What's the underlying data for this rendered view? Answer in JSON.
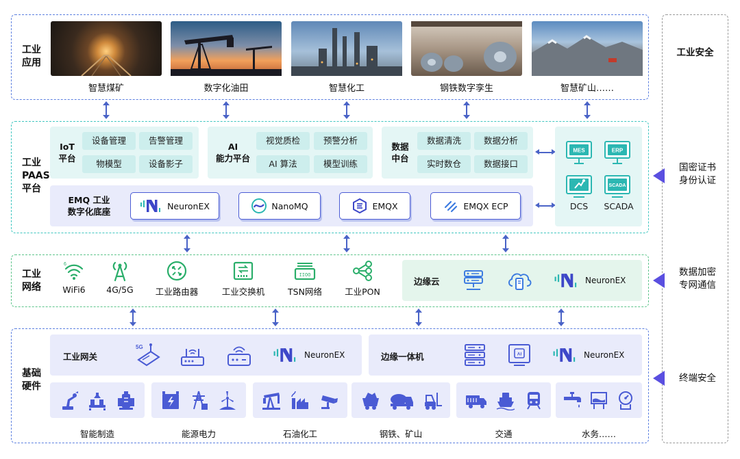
{
  "app": {
    "layers": [
      {
        "label": "工业\n应用"
      },
      {
        "label": "工业\nPAAS\n平台"
      },
      {
        "label": "工业\n网络"
      },
      {
        "label": "基础\n硬件"
      }
    ],
    "applications": [
      {
        "caption": "智慧煤矿"
      },
      {
        "caption": "数字化油田"
      },
      {
        "caption": "智慧化工"
      },
      {
        "caption": "钢铁数字孪生"
      },
      {
        "caption": "智慧矿山……"
      }
    ],
    "iot": {
      "label": "IoT\n平台",
      "items": [
        "设备管理",
        "告警管理",
        "物模型",
        "设备影子"
      ]
    },
    "ai": {
      "label": "AI\n能力平台",
      "items": [
        "视觉质检",
        "预警分析",
        "AI 算法",
        "模型训练"
      ]
    },
    "data_platform": {
      "label": "数据\n中台",
      "items": [
        "数据清洗",
        "数据分析",
        "实时数仓",
        "数据接口"
      ]
    },
    "emq_base": {
      "label": "EMQ 工业\n数字化底座",
      "products": [
        "NeuronEX",
        "NanoMQ",
        "EMQX",
        "EMQX ECP"
      ]
    },
    "systems": {
      "badges": [
        "MES",
        "ERP",
        "SCADA"
      ],
      "labels": [
        "DCS",
        "SCADA"
      ]
    },
    "network": {
      "items": [
        "WiFi6",
        "4G/5G",
        "工业路由器",
        "工业交换机",
        "TSN网络",
        "工业PON"
      ],
      "wifi_sub": "6",
      "edge_cloud": {
        "label": "边缘云",
        "product": "NeuronEX"
      }
    },
    "hardware": {
      "gateway": {
        "label": "工业网关",
        "product": "NeuronEX",
        "badge": "5G"
      },
      "edge_box": {
        "label": "边缘一体机",
        "product": "NeuronEX",
        "badge": "AI"
      },
      "groups": [
        "智能制造",
        "能源电力",
        "石油化工",
        "钢铁、矿山",
        "交通",
        "水务……"
      ]
    },
    "security": {
      "title": "工业安全",
      "items": [
        "国密证书\n身份认证",
        "数据加密\n专网通信",
        "终端安全"
      ]
    },
    "colors": {
      "accent": "#4a5bd4",
      "teal": "#2bb7b2",
      "security_arrow": "#5a4fe0",
      "panel_cyan": "#e4f6f5",
      "panel_lavender": "#e9ebfb",
      "panel_green": "#e4f5ec"
    }
  }
}
